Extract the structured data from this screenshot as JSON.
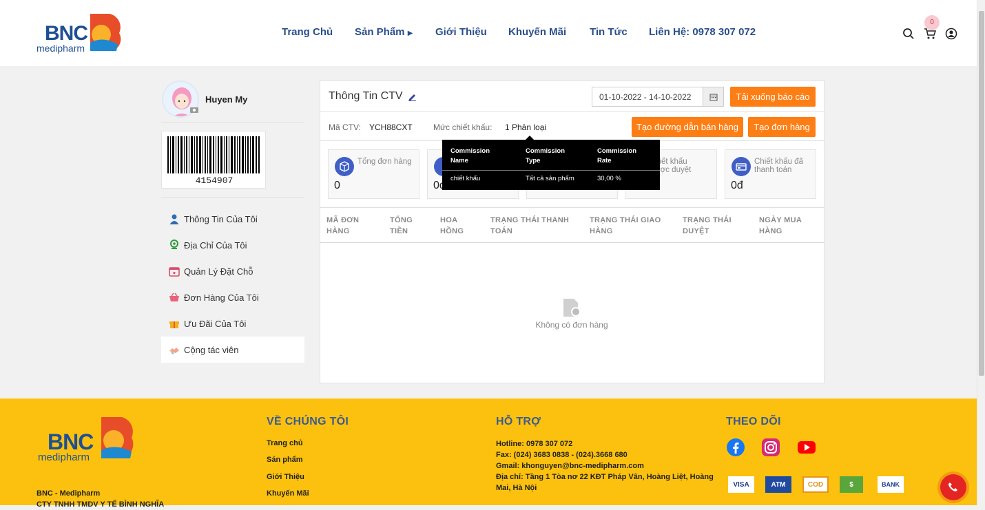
{
  "brand": {
    "name": "BNC",
    "sub": "medipharm"
  },
  "nav": {
    "home": "Trang Chủ",
    "products": "Sản Phẩm",
    "about": "Giới Thiệu",
    "promo": "Khuyến Mãi",
    "news": "Tin Tức",
    "contact": "Liên Hệ: 0978 307 072"
  },
  "cart": {
    "count": "0"
  },
  "profile": {
    "name": "Huyen My",
    "barcode": "4154907"
  },
  "sidebar": {
    "items": [
      {
        "label": "Thông Tin Của Tôi",
        "icon": "user-icon"
      },
      {
        "label": "Địa Chỉ Của Tôi",
        "icon": "location-pin-icon"
      },
      {
        "label": "Quản Lý Đặt Chỗ",
        "icon": "calendar-icon"
      },
      {
        "label": "Đơn Hàng Của Tôi",
        "icon": "basket-icon"
      },
      {
        "label": "Ưu Đãi Của Tôi",
        "icon": "gift-icon"
      },
      {
        "label": "Cộng tác viên",
        "icon": "handshake-icon"
      }
    ]
  },
  "main": {
    "title": "Thông Tin CTV",
    "date_range": "01-10-2022 - 14-10-2022",
    "download_btn": "Tải xuống báo cáo",
    "ctv_label": "Mã CTV:",
    "ctv_code": "YCH88CXT",
    "discount_label": "Mức chiết khấu:",
    "discount_value": "1 Phân loại",
    "create_link_btn": "Tạo đường dẫn bán hàng",
    "create_order_btn": "Tạo đơn hàng",
    "stats": [
      {
        "label": "Tổng đơn hàng",
        "value": "0"
      },
      {
        "label": "",
        "value": "0đ"
      },
      {
        "label": "",
        "value": ""
      },
      {
        "label": "hiết khấu\nược duyệt",
        "value": ""
      },
      {
        "label": "Chiết khấu đã thanh toán",
        "value": "0đ"
      }
    ],
    "table_headers": [
      "MÃ ĐƠN\nHÀNG",
      "TỔNG\nTIỀN",
      "HOA\nHỒNG",
      "TRẠNG THÁI THANH\nTOÁN",
      "TRẠNG THÁI GIAO\nHÀNG",
      "TRẠNG THÁI\nDUYỆT",
      "NGÀY MUA\nHÀNG"
    ],
    "empty_text": "Không có đơn hàng"
  },
  "tooltip": {
    "headers": [
      "Commission\nName",
      "Commission\nType",
      "Commission\nRate"
    ],
    "row": [
      "chiết khấu",
      "Tất cả sản phẩm",
      "30,00 %"
    ]
  },
  "footer": {
    "company_short": "BNC - Medipharm",
    "company_full": "CTY TNHH TMDV Y TẾ BÌNH NGHĨA",
    "about": {
      "heading": "VỀ CHÚNG TÔI",
      "links": [
        "Trang chủ",
        "Sản phẩm",
        "Giới Thiệu",
        "Khuyến Mãi"
      ]
    },
    "support": {
      "heading": "HỖ TRỢ",
      "hotline": "Hotline: 0978 307 072",
      "fax": "Fax: (024) 3683 0838 - (024).3668 680",
      "gmail": "Gmail: khonguyen@bnc-medipharm.com",
      "address": "Địa chỉ: Tầng 1 Tòa nơ 22 KĐT Pháp Vân, Hoàng Liệt, Hoàng Mai, Hà Nội"
    },
    "follow": {
      "heading": "THEO DÕI"
    },
    "payments": [
      "VISA",
      "ATM",
      "COD",
      "$",
      "BANK"
    ]
  },
  "colors": {
    "accent": "#fd7e14",
    "navy": "#2a4e8c",
    "footer": "#fcc10e"
  }
}
